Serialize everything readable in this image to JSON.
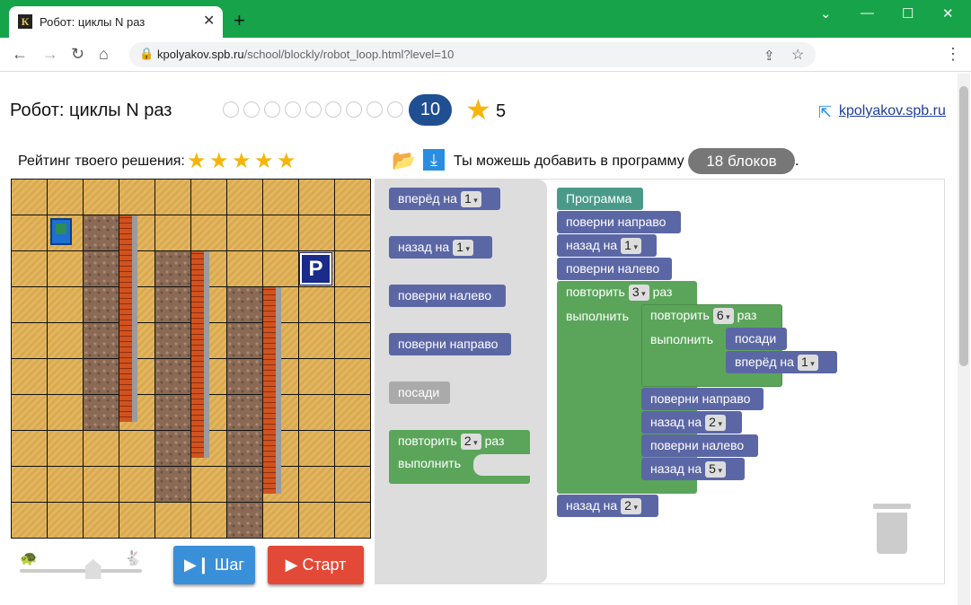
{
  "browser": {
    "tab_title": "Робот: циклы N раз",
    "favicon": "К",
    "new_tab": "+",
    "url_host": "kpolyakov.spb.ru",
    "url_path": "/school/blockly/robot_loop.html?level=10"
  },
  "header": {
    "title": "Робот: циклы N раз",
    "level": "10",
    "stars": "5",
    "link": "kpolyakov.spb.ru"
  },
  "rating": {
    "label": "Рейтинг твоего решения:",
    "stars_filled": 5
  },
  "program_info": {
    "text": "Ты можешь добавить в программу",
    "blocks_badge": "18 блоков",
    "dot": "."
  },
  "controls": {
    "step_label": "Шаг",
    "start_label": "Старт",
    "speed": 0.6
  },
  "field": {
    "parking_label": "P"
  },
  "toolbox": [
    {
      "text": "вперёд на",
      "value": "1"
    },
    {
      "text": "назад на",
      "value": "1"
    },
    {
      "text": "поверни налево"
    },
    {
      "text": "поверни направо"
    },
    {
      "text": "посади"
    },
    {
      "text": "повторить",
      "value": "2",
      "suffix": "раз",
      "do": "выполнить"
    }
  ],
  "program": {
    "root": "Программа",
    "b1": "поверни направо",
    "b2": "назад на",
    "b2v": "1",
    "b3": "поверни налево",
    "loop1": "повторить",
    "loop1v": "3",
    "loop1s": "раз",
    "loop1do": "выполнить",
    "loop2": "повторить",
    "loop2v": "6",
    "loop2s": "раз",
    "loop2do": "выполнить",
    "inner1": "посади",
    "inner2": "вперёд на",
    "inner2v": "1",
    "c1": "поверни направо",
    "c2": "назад на",
    "c2v": "2",
    "c3": "поверни налево",
    "c4": "назад на",
    "c4v": "5",
    "last": "назад на",
    "lastv": "2"
  }
}
